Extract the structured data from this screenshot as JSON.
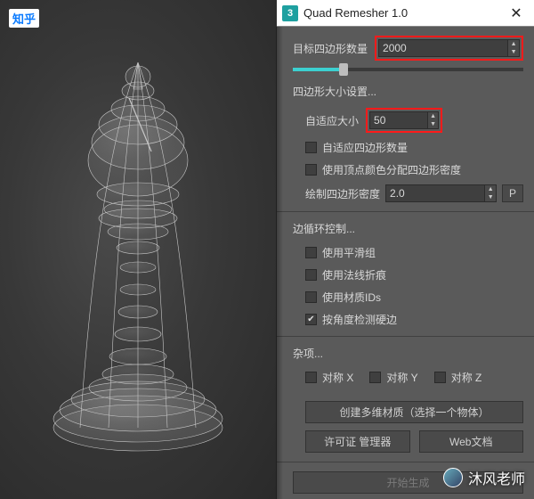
{
  "zhihu_badge": "知乎",
  "watermark": "沐风老师",
  "titlebar": {
    "icon": "3",
    "title": "Quad Remesher 1.0",
    "close": "✕"
  },
  "target": {
    "label": "目标四边形数量",
    "value": "2000"
  },
  "size_section": "四边形大小设置...",
  "adaptive": {
    "label": "自适应大小",
    "value": "50"
  },
  "cb_adaptive_count": "自适应四边形数量",
  "cb_vertex_color": "使用顶点颜色分配四边形密度",
  "paint_density": {
    "label": "绘制四边形密度",
    "value": "2.0",
    "btn": "P"
  },
  "edge_section": "边循环控制...",
  "cb_smooth": "使用平滑组",
  "cb_normal": "使用法线折痕",
  "cb_matid": "使用材质IDs",
  "cb_angle": "按角度检测硬边",
  "misc_section": "杂项...",
  "sym_x": "对称 X",
  "sym_y": "对称 Y",
  "sym_z": "对称 Z",
  "btn_multi": "创建多维材质（选择一个物体）",
  "btn_license": "许可证 管理器",
  "btn_web": "Web文档",
  "btn_start": "开始生成"
}
